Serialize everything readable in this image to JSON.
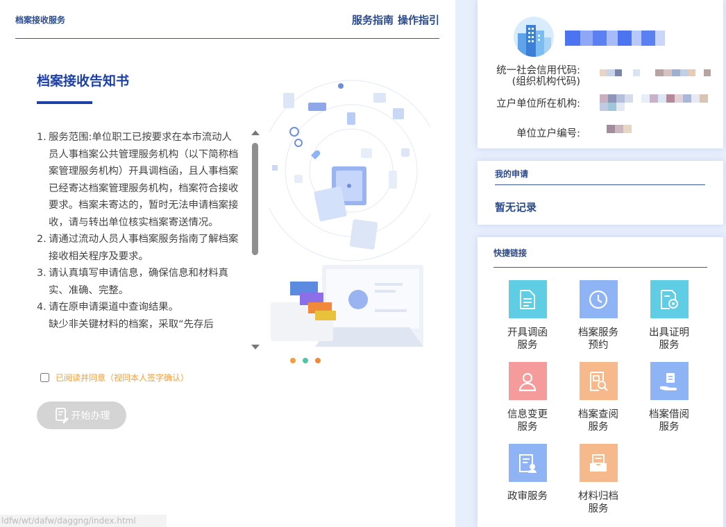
{
  "header": {
    "page_title": "档案接收服务",
    "link_guide": "服务指南",
    "link_steps": "操作指引"
  },
  "notice": {
    "title": "档案接收告知书",
    "items": [
      {
        "num": "1.",
        "text": "服务范围:单位职工已按要求在本市流动人员人事档案公共管理服务机构（以下简称档案管理服务机构）开具调档函，且人事档案已经寄达档案管理服务机构，档案符合接收要求。档案未寄达的，暂时无法申请档案接收，请与转出单位核实档案寄送情况。"
      },
      {
        "num": "2.",
        "text": "请通过流动人员人事档案服务指南了解档案接收相关程序及要求。"
      },
      {
        "num": "3.",
        "text": "请认真填写申请信息，确保信息和材料真实、准确、完整。"
      },
      {
        "num": "4.",
        "text": "请在原申请渠道中查询结果。"
      }
    ],
    "extra": "缺少非关键材料的档案，采取“先存后"
  },
  "agree": {
    "label": "已阅读并同意（视同本人签字确认）",
    "checked": false
  },
  "start_button": {
    "label": "开始办理"
  },
  "status_url": "ldfw/wt/dafw/daggng/index.html",
  "profile": {
    "credit_code_label_1": "统一社会信用代码:",
    "credit_code_label_2": "(组织机构代码)",
    "org_label": "立户单位所在机构:",
    "unit_no_label": "单位立户编号:"
  },
  "my_apply": {
    "title": "我的申请",
    "empty": "暂无记录"
  },
  "quick_links": {
    "title": "快捷链接",
    "items": [
      {
        "label_1": "开具调函",
        "label_2": "服务",
        "color": "#5fcde4",
        "icon": "document-icon"
      },
      {
        "label_1": "档案服务",
        "label_2": "预约",
        "color": "#8fb4f5",
        "icon": "clock-icon"
      },
      {
        "label_1": "出具证明",
        "label_2": "服务",
        "color": "#5fcde4",
        "icon": "certificate-icon"
      },
      {
        "label_1": "信息变更",
        "label_2": "服务",
        "color": "#f59b9b",
        "icon": "user-icon"
      },
      {
        "label_1": "档案查阅",
        "label_2": "服务",
        "color": "#f5b98c",
        "icon": "file-search-icon"
      },
      {
        "label_1": "档案借阅",
        "label_2": "服务",
        "color": "#8fb4f5",
        "icon": "hand-file-icon"
      },
      {
        "label_1": "政审服务",
        "label_2": "",
        "color": "#8fb4f5",
        "icon": "review-icon"
      },
      {
        "label_1": "材料归档",
        "label_2": "服务",
        "color": "#f5b98c",
        "icon": "archive-box-icon"
      }
    ]
  }
}
